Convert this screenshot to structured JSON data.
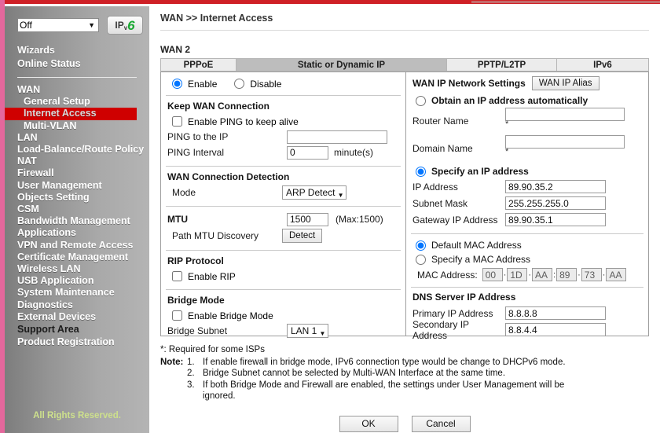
{
  "sidebar": {
    "ipv6_select_value": "Off",
    "ipv6_button_label": "IPv6",
    "top_items": [
      "Wizards",
      "Online Status"
    ],
    "menu": [
      {
        "label": "WAN",
        "level": "top",
        "active": false
      },
      {
        "label": "General Setup",
        "level": "sub",
        "active": false
      },
      {
        "label": "Internet Access",
        "level": "sub",
        "active": true
      },
      {
        "label": "Multi-VLAN",
        "level": "sub",
        "active": false
      },
      {
        "label": "LAN",
        "level": "top",
        "active": false
      },
      {
        "label": "Load-Balance/Route Policy",
        "level": "top",
        "active": false
      },
      {
        "label": "NAT",
        "level": "top",
        "active": false
      },
      {
        "label": "Firewall",
        "level": "top",
        "active": false
      },
      {
        "label": "User Management",
        "level": "top",
        "active": false
      },
      {
        "label": "Objects Setting",
        "level": "top",
        "active": false
      },
      {
        "label": "CSM",
        "level": "top",
        "active": false
      },
      {
        "label": "Bandwidth Management",
        "level": "top",
        "active": false
      },
      {
        "label": "Applications",
        "level": "top",
        "active": false
      },
      {
        "label": "VPN and Remote Access",
        "level": "top",
        "active": false
      },
      {
        "label": "Certificate Management",
        "level": "top",
        "active": false
      },
      {
        "label": "Wireless LAN",
        "level": "top",
        "active": false
      },
      {
        "label": "USB Application",
        "level": "top",
        "active": false
      },
      {
        "label": "System Maintenance",
        "level": "top",
        "active": false
      },
      {
        "label": "Diagnostics",
        "level": "top",
        "active": false
      },
      {
        "label": "External Devices",
        "level": "top",
        "active": false
      }
    ],
    "support_area": "Support Area",
    "product_registration": "Product Registration",
    "rights": "All Rights Reserved."
  },
  "header": {
    "breadcrumb": "WAN >> Internet Access",
    "section_title": "WAN 2"
  },
  "tabs": [
    {
      "label": "PPPoE",
      "active": false
    },
    {
      "label": "Static or Dynamic IP",
      "active": true
    },
    {
      "label": "PPTP/L2TP",
      "active": false
    },
    {
      "label": "IPv6",
      "active": false
    }
  ],
  "left": {
    "enable_label": "Enable",
    "disable_label": "Disable",
    "enable_selected": true,
    "keep_wan": {
      "title": "Keep WAN Connection",
      "ping_keepalive_label": "Enable PING to keep alive",
      "ping_keepalive_checked": false,
      "ping_ip_label": "PING to the IP",
      "ping_ip_value": "",
      "ping_interval_label": "PING Interval",
      "ping_interval_value": "0",
      "ping_interval_unit": "minute(s)"
    },
    "detection": {
      "title": "WAN Connection Detection",
      "mode_label": "Mode",
      "mode_value": "ARP Detect"
    },
    "mtu": {
      "title": "MTU",
      "value": "1500",
      "max_hint": "(Max:1500)",
      "path_mtu_label": "Path MTU Discovery",
      "detect_button": "Detect"
    },
    "rip": {
      "title": "RIP Protocol",
      "enable_label": "Enable RIP",
      "enable_checked": false
    },
    "bridge": {
      "title": "Bridge Mode",
      "enable_label": "Enable Bridge Mode",
      "enable_checked": false,
      "subnet_label": "Bridge Subnet",
      "subnet_value": "LAN 1"
    }
  },
  "right": {
    "wan_ip_title": "WAN IP Network Settings",
    "wan_ip_alias_button": "WAN IP Alias",
    "obtain_auto_label": "Obtain an IP address automatically",
    "obtain_auto_selected": false,
    "router_name_label": "Router Name",
    "router_name_value": "",
    "domain_name_label": "Domain Name",
    "domain_name_value": "",
    "required_star": "*",
    "specify_ip_label": "Specify an IP address",
    "specify_ip_selected": true,
    "ip_address_label": "IP Address",
    "ip_address_value": "89.90.35.2",
    "subnet_mask_label": "Subnet Mask",
    "subnet_mask_value": "255.255.255.0",
    "gateway_label": "Gateway IP Address",
    "gateway_value": "89.90.35.1",
    "default_mac_label": "Default MAC Address",
    "default_mac_selected": true,
    "specify_mac_label": "Specify a MAC Address",
    "specify_mac_selected": false,
    "mac_address_label": "MAC Address:",
    "mac_octets": [
      "00",
      "1D",
      "AA",
      "89",
      "73",
      "AA"
    ],
    "dns_title": "DNS Server IP Address",
    "primary_dns_label": "Primary IP Address",
    "primary_dns_value": "8.8.8.8",
    "secondary_dns_label": "Secondary IP Address",
    "secondary_dns_value": "8.8.4.4"
  },
  "notes": {
    "star_line": "*: Required for some ISPs",
    "lead": "Note:",
    "items": [
      {
        "num": "1.",
        "text": "If enable firewall in bridge mode, IPv6 connection type would be change to DHCPv6 mode."
      },
      {
        "num": "2.",
        "text": "Bridge Subnet cannot be selected by Multi-WAN Interface at the same time."
      },
      {
        "num": "3.",
        "text": "If both Bridge Mode and Firewall are enabled, the settings under User Management will be"
      }
    ],
    "continuation": "ignored."
  },
  "actions": {
    "ok_label": "OK",
    "cancel_label": "Cancel"
  },
  "colors": {
    "accent_red": "#cf2026",
    "highlight_red": "#cf0000",
    "sidebar_pink": "#e4679c",
    "rights_green": "#cde08c",
    "ipv6_green": "#1aa832"
  }
}
